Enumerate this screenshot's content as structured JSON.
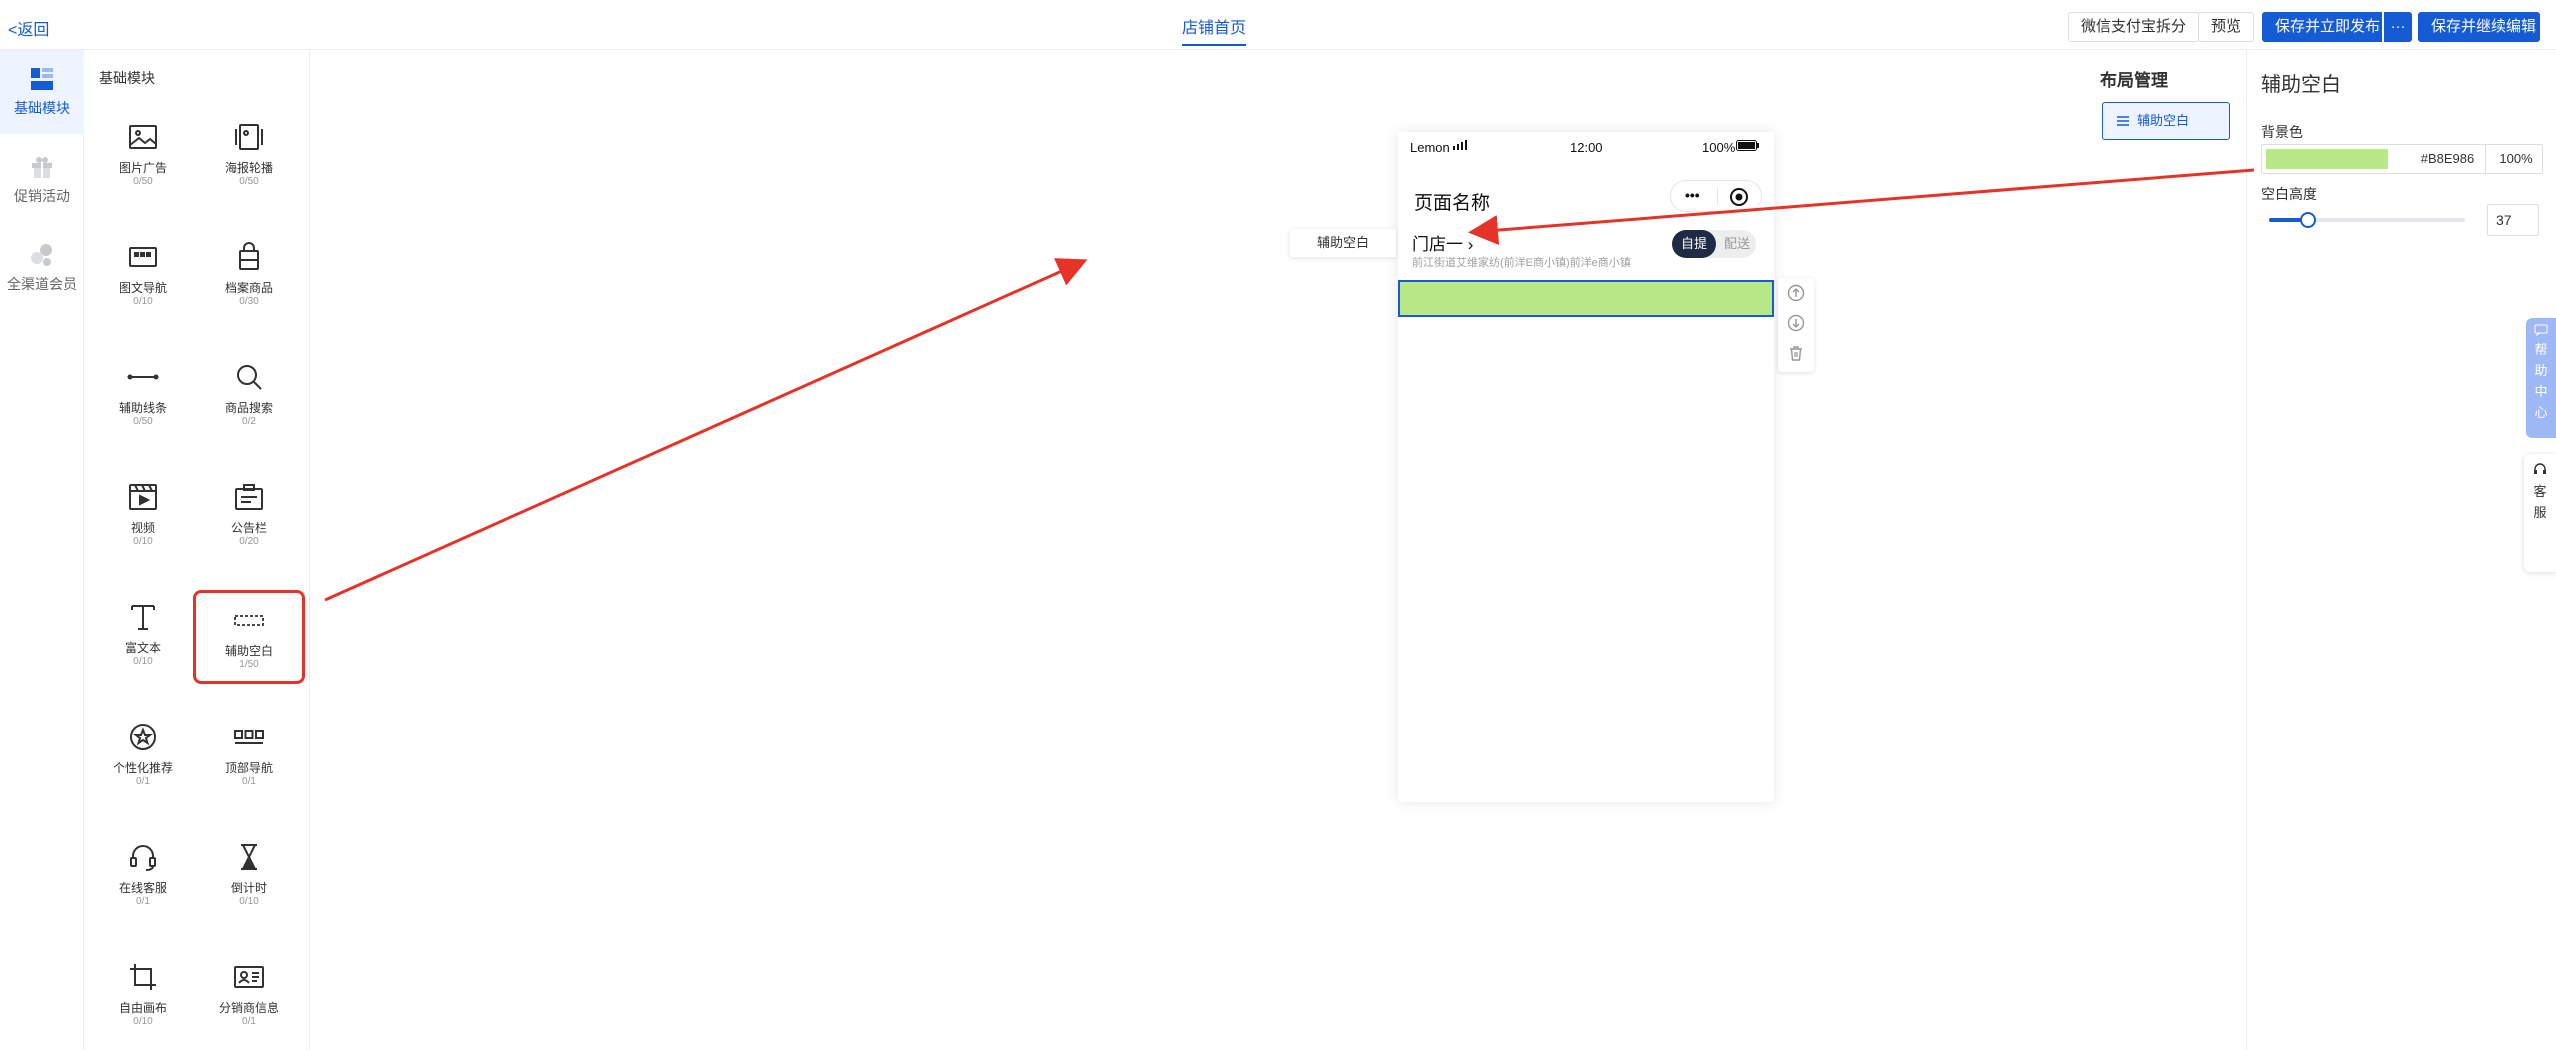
{
  "topbar": {
    "back_label": "<返回",
    "page_tab": "店铺首页",
    "btn_wechat_pay": "微信支付宝拆分",
    "btn_preview": "预览",
    "btn_save_publish": "保存并立即发布",
    "btn_more": "···",
    "btn_save_continue": "保存并继续编辑"
  },
  "rail": {
    "items": [
      {
        "label": "基础模块"
      },
      {
        "label": "促销活动"
      },
      {
        "label": "全渠道会员"
      }
    ]
  },
  "panel": {
    "title": "基础模块",
    "components": [
      {
        "name": "图片广告",
        "count": "0/50"
      },
      {
        "name": "海报轮播",
        "count": "0/50"
      },
      {
        "name": "图文导航",
        "count": "0/10"
      },
      {
        "name": "档案商品",
        "count": "0/30"
      },
      {
        "name": "辅助线条",
        "count": "0/50"
      },
      {
        "name": "商品搜索",
        "count": "0/2"
      },
      {
        "name": "视频",
        "count": "0/10"
      },
      {
        "name": "公告栏",
        "count": "0/20"
      },
      {
        "name": "富文本",
        "count": "0/10"
      },
      {
        "name": "辅助空白",
        "count": "1/50"
      },
      {
        "name": "个性化推荐",
        "count": "0/1"
      },
      {
        "name": "顶部导航",
        "count": "0/1"
      },
      {
        "name": "在线客服",
        "count": "0/1"
      },
      {
        "name": "倒计时",
        "count": "0/10"
      },
      {
        "name": "自由画布",
        "count": "0/10"
      },
      {
        "name": "分销商信息",
        "count": "0/1"
      }
    ]
  },
  "phone": {
    "carrier": "Lemon",
    "time": "12:00",
    "battery": "100%",
    "page_title": "页面名称",
    "store_name": "门店一 ›",
    "address": "前江街道艾维家纺(前洋E商小镇)前洋e商小镇",
    "pickup": "自提",
    "delivery": "配送"
  },
  "canvas": {
    "blank_tag": "辅助空白",
    "layout_title": "布局管理",
    "layout_item": "辅助空白"
  },
  "settings": {
    "title": "辅助空白",
    "bg_label": "背景色",
    "bg_hex": "#B8E986",
    "bg_opacity": "100%",
    "height_label": "空白高度",
    "height_value": "37",
    "height_fraction": 0.2
  },
  "floating": {
    "help": [
      "帮",
      "助",
      "中",
      "心"
    ],
    "service": [
      "客",
      "服"
    ]
  },
  "colors": {
    "brand": "#155bd4",
    "blank_bg": "#b8e986",
    "annotation": "#e5332a"
  }
}
